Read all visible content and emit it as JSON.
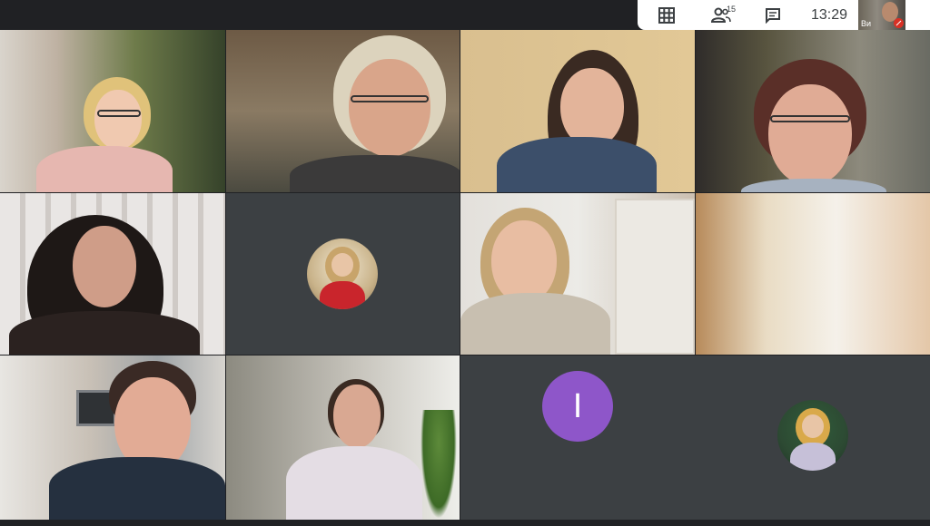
{
  "toolbar": {
    "participants_count": "15",
    "clock": "13:29",
    "self_label": "Ви"
  },
  "avatar_letter": "I",
  "colors": {
    "tile_bg": "#3c4043",
    "page_bg": "#202124",
    "avatar_letter_bg": "#8e56c9",
    "mic_off": "#d93025"
  },
  "icons": [
    "grid-layout-icon",
    "people-icon",
    "chat-icon",
    "mic-off-icon"
  ]
}
